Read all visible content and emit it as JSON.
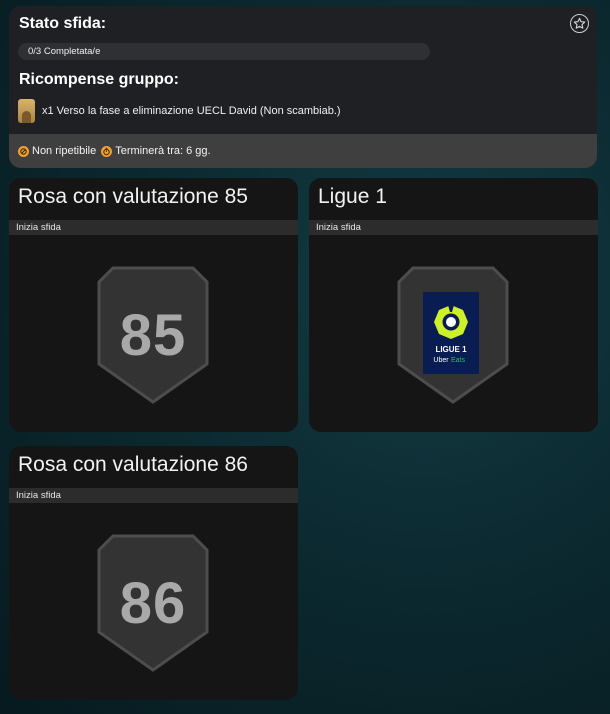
{
  "status": {
    "title": "Stato sfida:",
    "progress_label": "0/3 Completata/e",
    "progress_fraction": 0,
    "rewards_title": "Ricompense gruppo:",
    "reward_text": "x1 Verso la fase a eliminazione UECL David (Non scambiab.)",
    "info_not_repeatable": "Non ripetibile",
    "info_ends": "Terminerà tra: 6 gg."
  },
  "cards": [
    {
      "title": "Rosa con valutazione 85",
      "strip": "Inizia sfida",
      "badge": "85"
    },
    {
      "title": "Ligue 1",
      "strip": "Inizia sfida",
      "logo_line1": "LIGUE 1",
      "logo_line2a": "Uber",
      "logo_line2b": "Eats"
    },
    {
      "title": "Rosa con valutazione 86",
      "strip": "Inizia sfida",
      "badge": "86"
    }
  ],
  "colors": {
    "panel": "#1e2024",
    "card": "#151515",
    "accent_lime": "#cdf02a",
    "info_orange": "#f1a22a",
    "logo_navy": "#0a1d52",
    "uber_eats_green": "#1dbf73"
  }
}
